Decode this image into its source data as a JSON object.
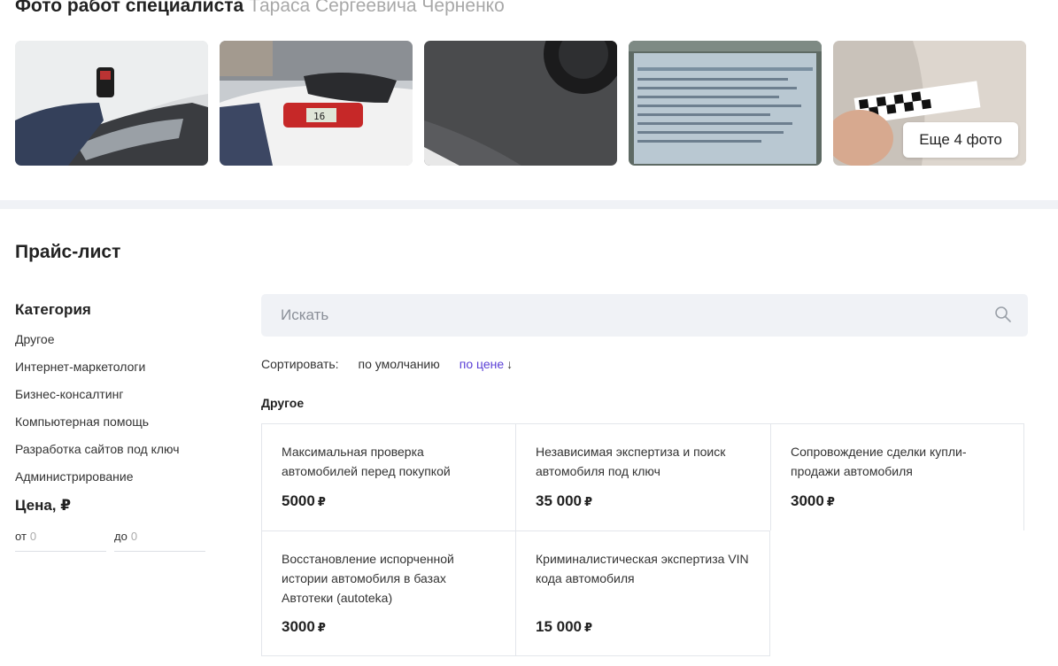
{
  "photos": {
    "title": "Фото работ специалиста",
    "specialist": "Тараса Сергеевича Черненко",
    "more_label": "Еще 4 фото",
    "items": [
      "photo-1",
      "photo-2",
      "photo-3",
      "photo-4",
      "photo-5"
    ]
  },
  "price_list": {
    "title": "Прайс-лист",
    "category_heading": "Категория",
    "categories": [
      "Другое",
      "Интернет-маркетологи",
      "Бизнес-консалтинг",
      "Компьютерная помощь",
      "Разработка сайтов под ключ",
      "Администрирование"
    ],
    "price_heading": "Цена, ₽",
    "from_label": "от",
    "from_placeholder": "0",
    "to_label": "до",
    "to_placeholder": "0",
    "search_placeholder": "Искать",
    "sort_label": "Сортировать:",
    "sort_default": "по умолчанию",
    "sort_price": "по цене",
    "sort_arrow": "↓",
    "group_title": "Другое",
    "currency": "₽",
    "services": [
      {
        "title": "Максимальная проверка автомобилей перед покупкой",
        "price": "5000"
      },
      {
        "title": "Независимая экспертиза и поиск автомобиля под ключ",
        "price": "35 000"
      },
      {
        "title": "Сопровождение сделки купли-продажи автомобиля",
        "price": "3000"
      },
      {
        "title": "Восстановление испорченной истории автомобиля в базах Автотеки (autoteka)",
        "price": "3000"
      },
      {
        "title": "Криминалистическая экспертиза VIN кода автомобиля",
        "price": "15 000"
      }
    ]
  },
  "colors": {
    "accent": "#5a3fd6",
    "search_bg": "#f0f2f6",
    "border": "#e3e6eb"
  }
}
